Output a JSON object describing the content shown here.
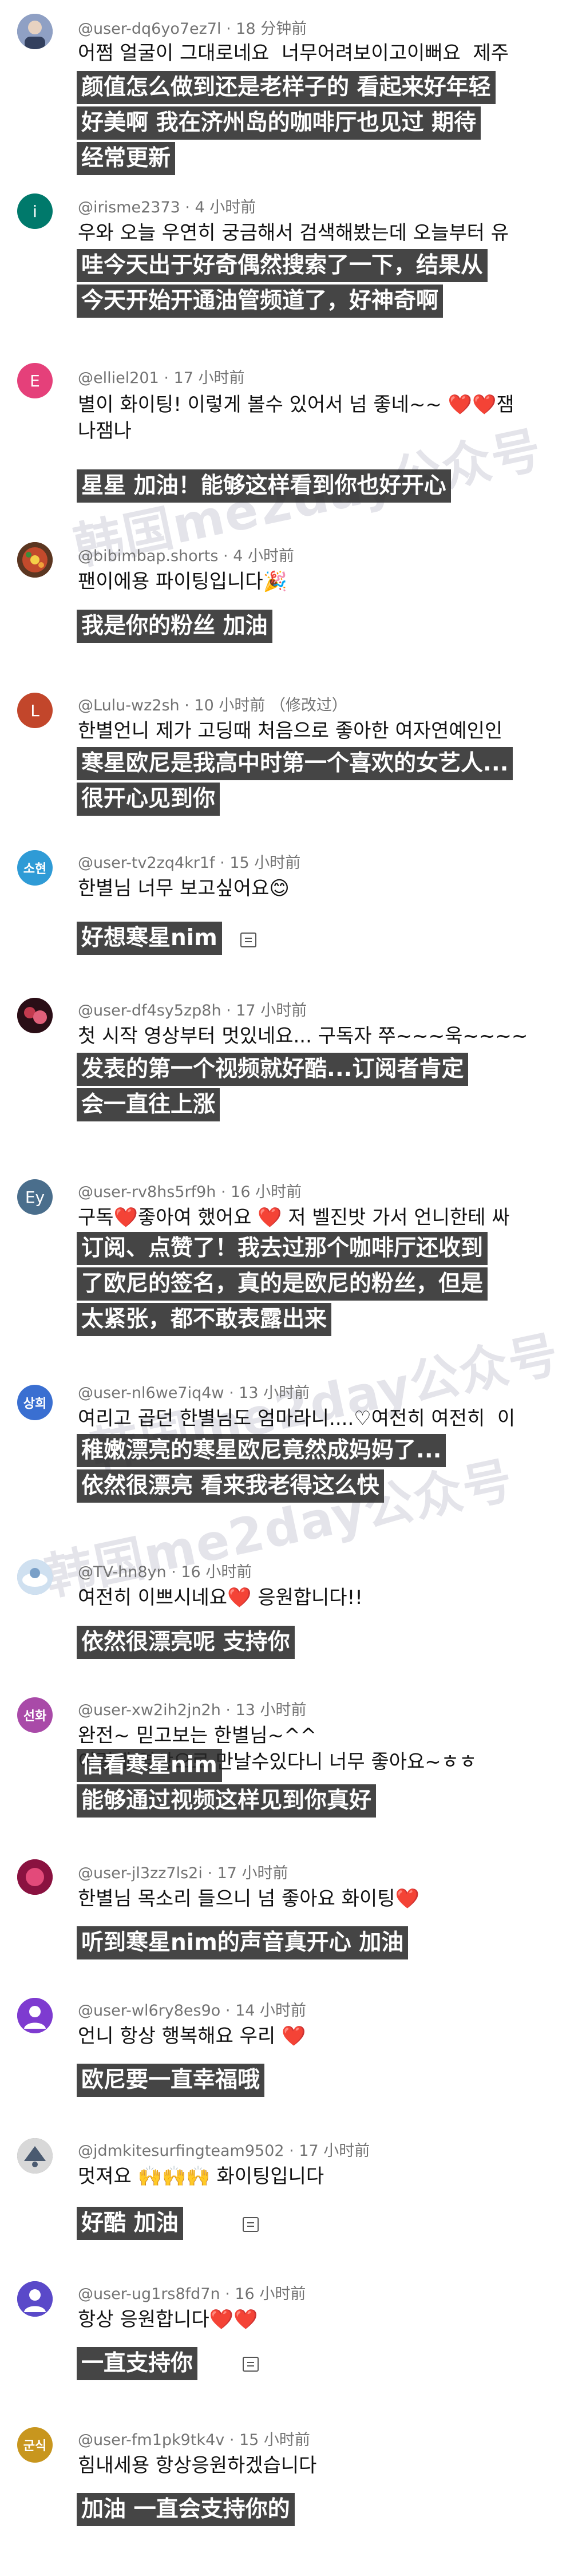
{
  "watermark": [
    "韩国me2day公众号",
    "韩国me2day公众号",
    "韩国me2day公众号"
  ],
  "comments": [
    {
      "user": "@user-dq6yo7ez7l",
      "time": "18 分钟前",
      "ko": "어쩜 얼굴이 그대로네요  너무어려보이고이뻐요  제주",
      "cn": [
        "颜值怎么做到还是老样子的 看起来好年轻",
        "好美啊 我在济州岛的咖啡厅也见过 期待",
        "经常更新"
      ],
      "avatar_text": "",
      "avatar_color": "#6f7faa"
    },
    {
      "user": "@irisme2373",
      "time": "4 小时前",
      "ko": "우와 오늘 우연히 궁금해서 검색해봤는데 오늘부터 유",
      "cn": [
        "哇今天出于好奇偶然搜索了一下，结果从",
        "今天开始开通油管频道了，好神奇啊"
      ],
      "avatar_text": "i",
      "avatar_color": "#00796b"
    },
    {
      "user": "@elliel201",
      "time": "17 小时前",
      "ko": "별이 화이팅! 이렇게 볼수 있어서 넘 좋네~~ ❤️❤️잼\n나잼나",
      "cn": [
        "星星 加油！能够这样看到你也好开心"
      ],
      "avatar_text": "E",
      "avatar_color": "#e5407a"
    },
    {
      "user": "@bibimbap.shorts",
      "time": "4 小时前",
      "ko": "팬이에용 파이팅입니다🎉",
      "cn": [
        "我是你的粉丝 加油"
      ],
      "avatar_text": "",
      "avatar_color": "#8a4b2c"
    },
    {
      "user": "@Lulu-wz2sh",
      "time": "10 小时前 （修改过）",
      "ko": "한별언니 제가 고딩때 처음으로 좋아한 여자연예인인",
      "cn": [
        "寒星欧尼是我高中时第一个喜欢的女艺人...",
        "很开心见到你"
      ],
      "avatar_text": "L",
      "avatar_color": "#c2462b"
    },
    {
      "user": "@user-tv2zq4kr1f",
      "time": "15 小时前",
      "ko": "한별님 너무 보고싶어요😊",
      "cn": [
        "好想寒星nim"
      ],
      "avatar_text": "소현",
      "avatar_color": "#2f9bd6"
    },
    {
      "user": "@user-df4sy5zp8h",
      "time": "17 小时前",
      "ko": "첫 시작 영상부터 멋있네요... 구독자 쭈~~~욱~~~~",
      "cn": [
        "发表的第一个视频就好酷...订阅者肯定",
        "会一直往上涨"
      ],
      "avatar_text": "",
      "avatar_color": "#7a1f3a"
    },
    {
      "user": "@user-rv8hs5rf9h",
      "time": "16 小时前",
      "ko": "구독❤️좋아여 했어요 ❤️ 저 벨진밧 가서 언니한테 싸",
      "cn": [
        "订阅、点赞了！我去过那个咖啡厅还收到",
        "了欧尼的签名，真的是欧尼的粉丝，但是",
        "太紧张，都不敢表露出来"
      ],
      "avatar_text": "Ey",
      "avatar_color": "#4a6e8c"
    },
    {
      "user": "@user-nl6we7iq4w",
      "time": "13 小时前",
      "ko": "여리고 곱던 한별님도 엄마라니....♡여전히 여전히  이",
      "cn": [
        "稚嫩漂亮的寒星欧尼竟然成妈妈了...",
        "依然很漂亮 看来我老得这么快"
      ],
      "avatar_text": "상희",
      "avatar_color": "#3a6fd1"
    },
    {
      "user": "@TV-hn8yn",
      "time": "16 小时前",
      "ko": "여전히 이쁘시네요❤️ 응원합니다!!",
      "cn": [
        "依然很漂亮呢 支持你"
      ],
      "avatar_text": "",
      "avatar_color": "#9ab7d8"
    },
    {
      "user": "@user-xw2ih2jn2h",
      "time": "13 小时前",
      "ko": "완전~ 믿고보는 한별님~^^\n이렇게 영상으로 만날수있다니 너무 좋아요~ㅎㅎ",
      "cn": [
        "信看寒星nim",
        "能够通过视频这样见到你真好"
      ],
      "avatar_text": "선화",
      "avatar_color": "#a94aa8"
    },
    {
      "user": "@user-jl3zz7ls2i",
      "time": "17 小时前",
      "ko": "한별님 목소리 들으니 넘 좋아요 화이팅❤️",
      "cn": [
        "听到寒星nim的声音真开心 加油"
      ],
      "avatar_text": "",
      "avatar_color": "#a11b4f"
    },
    {
      "user": "@user-wl6ry8es9o",
      "time": "14 小时前",
      "ko": "언니 항상 행복해요 우리 ❤️",
      "cn": [
        "欧尼要一直幸福哦"
      ],
      "avatar_text": "",
      "avatar_color": "#7e3bd0"
    },
    {
      "user": "@jdmkitesurfingteam9502",
      "time": "17 小时前",
      "ko": "멋져요 🙌🙌🙌 화이팅입니다",
      "cn": [
        "好酷 加油"
      ],
      "avatar_text": "",
      "avatar_color": "#8e8e8e"
    },
    {
      "user": "@user-ug1rs8fd7n",
      "time": "16 小时前",
      "ko": "항상 응원합니다❤️❤️",
      "cn": [
        "一直支持你"
      ],
      "avatar_text": "",
      "avatar_color": "#5a49c9"
    },
    {
      "user": "@user-fm1pk9tk4v",
      "time": "15 小时前",
      "ko": "힘내세용 항상응원하겠습니다",
      "cn": [
        "加油 一直会支持你的"
      ],
      "avatar_text": "군식",
      "avatar_color": "#c8961e"
    }
  ]
}
